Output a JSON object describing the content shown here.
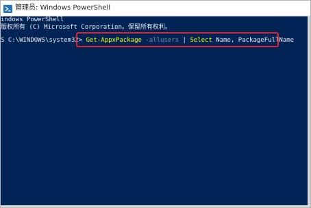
{
  "window": {
    "title": "管理员: Windows PowerShell",
    "icon": "powershell-icon"
  },
  "console": {
    "banner_line1": "indows PowerShell",
    "banner_line2": "版权所有 (C) Microsoft Corporation。保留所有权利。",
    "prompt": "S C:\\WINDOWS\\system32> ",
    "command": {
      "cmdlet": "Get-AppxPackage",
      "param": " -allusers",
      "pipe": " | ",
      "select": "Select",
      "args": " Name, PackageFullName"
    }
  },
  "colors": {
    "console_background": "#012456",
    "console_text": "#eeedf0",
    "cmdlet": "#ffff00",
    "parameter": "#7f8a9a",
    "highlight_box": "#e4232c"
  }
}
